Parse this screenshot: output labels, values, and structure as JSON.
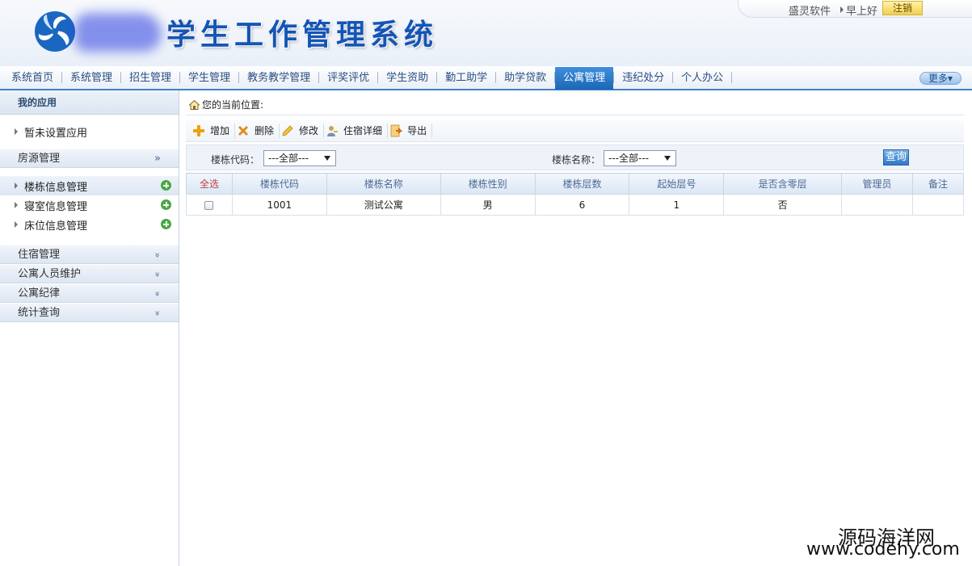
{
  "header": {
    "title": "学生工作管理系统",
    "company": "盛灵软件",
    "greeting": "早上好",
    "logout": "注销"
  },
  "nav": {
    "items": [
      "系统首页",
      "系统管理",
      "招生管理",
      "学生管理",
      "教务教学管理",
      "评奖评优",
      "学生资助",
      "勤工助学",
      "助学贷款",
      "公寓管理",
      "违纪处分",
      "个人办公"
    ],
    "active": "公寓管理",
    "more": "更多"
  },
  "sidebar": {
    "my_apps": "我的应用",
    "no_app": "暂未设置应用",
    "housing": {
      "title": "房源管理",
      "toggle": "»",
      "items": [
        "楼栋信息管理",
        "寝室信息管理",
        "床位信息管理"
      ]
    },
    "groups": [
      "住宿管理",
      "公寓人员维护",
      "公寓纪律",
      "统计查询"
    ],
    "group_toggle": "»"
  },
  "main": {
    "breadcrumb": "您的当前位置:",
    "toolbar": {
      "add": "增加",
      "delete": "删除",
      "edit": "修改",
      "detail": "住宿详细",
      "export": "导出"
    },
    "filter": {
      "code_label": "楼栋代码：",
      "code_value": "---全部---",
      "name_label": "楼栋名称：",
      "name_value": "---全部---",
      "query": "查询"
    },
    "table": {
      "headers": [
        "全选",
        "楼栋代码",
        "楼栋名称",
        "楼栋性别",
        "楼栋层数",
        "起始层号",
        "是否含零层",
        "管理员",
        "备注"
      ],
      "rows": [
        {
          "code": "1001",
          "name": "测试公寓",
          "gender": "男",
          "floors": "6",
          "start": "1",
          "zero": "否",
          "admin": "",
          "note": ""
        }
      ]
    }
  },
  "watermark": {
    "cn": "源码海洋网",
    "url": "www.codehy.com"
  },
  "colors": {
    "accent": "#1c66b6",
    "title": "#1455b6",
    "add_green": "#49a843"
  }
}
